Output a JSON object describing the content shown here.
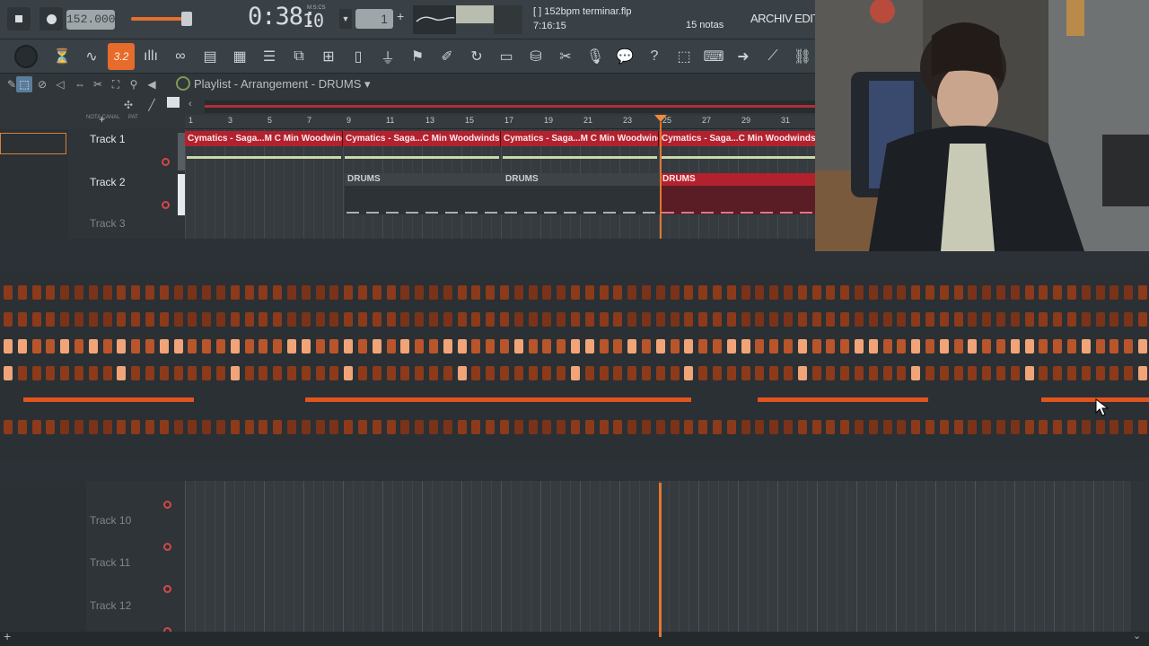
{
  "transport": {
    "tempo": "152.000",
    "time_main": "0:38:",
    "time_ms": "10",
    "time_mscs_label": "M:S:CS",
    "pattern_number": "1",
    "pattern_plus": "+"
  },
  "project": {
    "file_name": "[  ] 152bpm terminar.flp",
    "time": "7:16:15",
    "notes_count": "15 notas",
    "archive_label": "ARCHIV EDITAC"
  },
  "toolbar": {
    "snap_label": "3.2",
    "icons": [
      "metronome-icon",
      "wave-icon",
      "snap-icon",
      "mixer-icon",
      "wave-alt-icon",
      "piano-roll-icon",
      "bars-icon",
      "list-icon",
      "channel-icon",
      "browser-icon",
      "file-icon",
      "plugin-icon",
      "marker-icon",
      "pen-icon",
      "loop-icon",
      "save-icon",
      "zip-icon",
      "scissors-icon",
      "mic-icon",
      "chat-icon",
      "help-icon",
      "window-icon",
      "keyboard-icon",
      "arrow-right-icon",
      "brush-icon",
      "link-icon"
    ]
  },
  "playlist": {
    "title": "Playlist - Arrangement",
    "pattern": "DRUMS",
    "ruler_ticks": [
      "1",
      "3",
      "5",
      "7",
      "9",
      "11",
      "13",
      "15",
      "17",
      "19",
      "21",
      "23",
      "25",
      "27",
      "29",
      "31"
    ],
    "ruler_header": "NOTA CANAL",
    "pat_label": "PAT",
    "tracks": [
      {
        "name": "Track 1"
      },
      {
        "name": "Track 2"
      },
      {
        "name": "Track 3"
      }
    ],
    "audio_clips": [
      {
        "label": "Cymatics - Saga...M C Min Woodwinds"
      },
      {
        "label": "Cymatics - Saga...C Min Woodwinds"
      },
      {
        "label": "Cymatics - Saga...M C Min Woodwinds"
      },
      {
        "label": "Cymatics - Saga...C Min Woodwinds"
      }
    ],
    "drum_clips": [
      {
        "label": "DRUMS"
      },
      {
        "label": "DRUMS"
      },
      {
        "label": "DRUMS"
      }
    ],
    "lower_tracks": [
      {
        "name": "Track 10"
      },
      {
        "name": "Track 11"
      },
      {
        "name": "Track 12"
      }
    ]
  },
  "colors": {
    "accent": "#e76b2a",
    "clip_red": "#b3212f",
    "pad_dark": "#8c3a1a",
    "pad_mid": "#b8552a",
    "pad_light": "#f0a478"
  }
}
